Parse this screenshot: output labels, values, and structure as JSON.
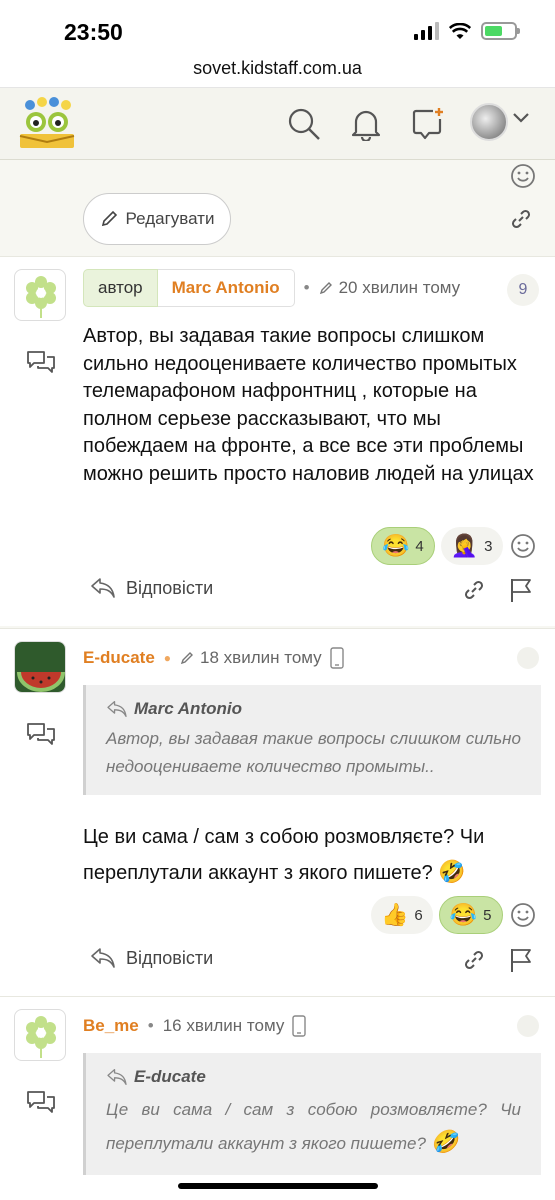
{
  "status": {
    "time": "23:50"
  },
  "browser": {
    "url": "sovet.kidstaff.com.ua"
  },
  "top_actions": {
    "edit_label": "Редагувати"
  },
  "posts": [
    {
      "author_tag": "автор",
      "name": "Marc Antonio",
      "time": "20 хвилин тому",
      "number": "9",
      "text": "Автор, вы задавая такие вопросы слишком сильно недооцениваете количество промытых телемарафоном нафронтниц , которые на полном серьезе рассказывают, что мы побеждаем на фронте, а все все эти проблемы можно решить просто наловив людей на улицах",
      "reactions": [
        {
          "emoji": "😂",
          "count": "4",
          "active": true
        },
        {
          "emoji": "🤦‍♀️",
          "count": "3",
          "active": false
        }
      ],
      "reply_label": "Відповісти"
    },
    {
      "name": "E-ducate",
      "time": "18 хвилин тому",
      "quote_author": "Marc Antonio",
      "quote_text": "Автор, вы задавая такие вопросы слишком сильно недооцениваете количество промыты..",
      "text": "Це ви сама / сам з собою розмовляєте? Чи переплутали аккаунт з якого пишете?",
      "text_emoji": "🤣",
      "reactions": [
        {
          "emoji": "👍",
          "count": "6",
          "active": false
        },
        {
          "emoji": "😂",
          "count": "5",
          "active": true
        }
      ],
      "reply_label": "Відповісти"
    },
    {
      "name": "Be_me",
      "time": "16 хвилин тому",
      "quote_author": "E-ducate",
      "quote_text": "Це ви сама / сам з собою розмовляєте? Чи переплутали аккаунт з якого пишете?",
      "quote_emoji": "🤣"
    }
  ]
}
